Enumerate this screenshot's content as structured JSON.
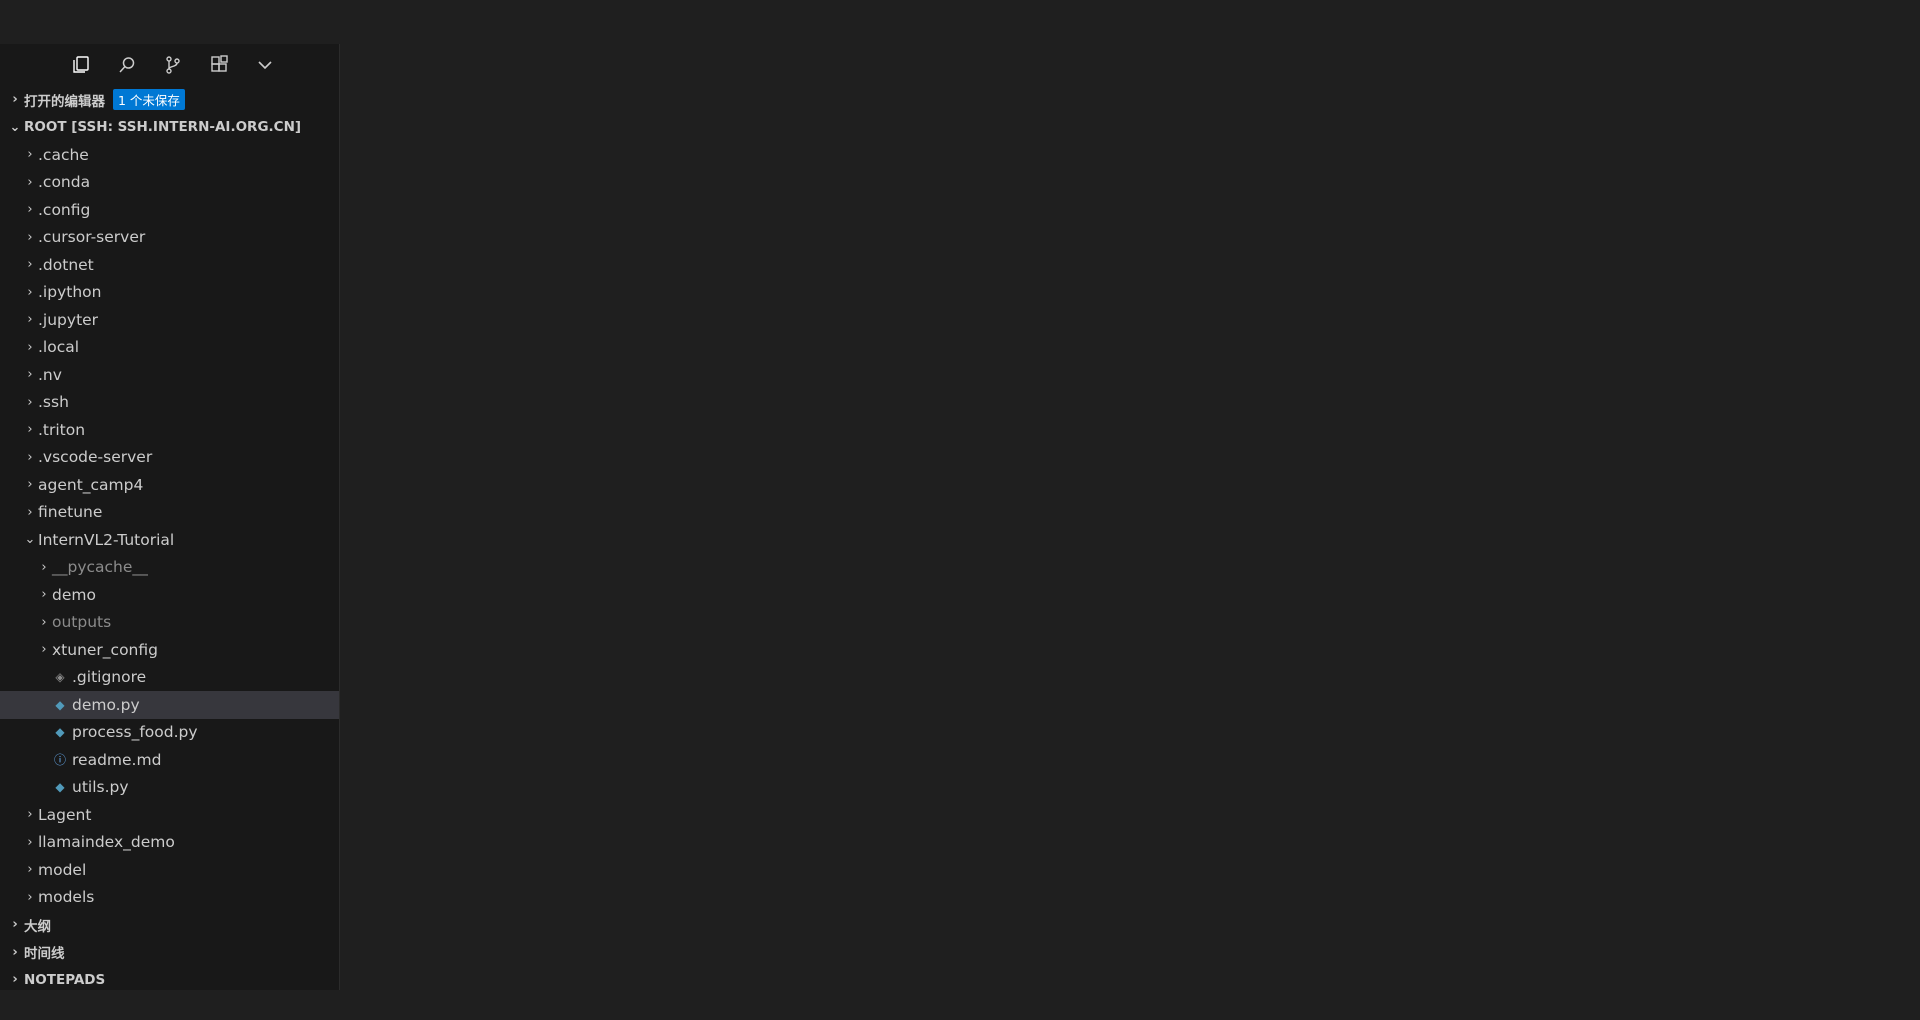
{
  "sections": {
    "open_editors": {
      "label": "打开的编辑器",
      "badge": "1 个未保存"
    },
    "root": {
      "label": "ROOT [SSH: SSH.INTERN-AI.ORG.CN]"
    },
    "outline": {
      "label": "大纲"
    },
    "timeline": {
      "label": "时间线"
    },
    "notepads": {
      "label": "NOTEPADS"
    }
  },
  "tree": [
    {
      "label": ".cache",
      "kind": "folder",
      "depth": 1,
      "expanded": false
    },
    {
      "label": ".conda",
      "kind": "folder",
      "depth": 1,
      "expanded": false
    },
    {
      "label": ".config",
      "kind": "folder",
      "depth": 1,
      "expanded": false
    },
    {
      "label": ".cursor-server",
      "kind": "folder",
      "depth": 1,
      "expanded": false
    },
    {
      "label": ".dotnet",
      "kind": "folder",
      "depth": 1,
      "expanded": false
    },
    {
      "label": ".ipython",
      "kind": "folder",
      "depth": 1,
      "expanded": false
    },
    {
      "label": ".jupyter",
      "kind": "folder",
      "depth": 1,
      "expanded": false
    },
    {
      "label": ".local",
      "kind": "folder",
      "depth": 1,
      "expanded": false
    },
    {
      "label": ".nv",
      "kind": "folder",
      "depth": 1,
      "expanded": false
    },
    {
      "label": ".ssh",
      "kind": "folder",
      "depth": 1,
      "expanded": false
    },
    {
      "label": ".triton",
      "kind": "folder",
      "depth": 1,
      "expanded": false
    },
    {
      "label": ".vscode-server",
      "kind": "folder",
      "depth": 1,
      "expanded": false
    },
    {
      "label": "agent_camp4",
      "kind": "folder",
      "depth": 1,
      "expanded": false
    },
    {
      "label": "finetune",
      "kind": "folder",
      "depth": 1,
      "expanded": false
    },
    {
      "label": "InternVL2-Tutorial",
      "kind": "folder",
      "depth": 1,
      "expanded": true
    },
    {
      "label": "__pycache__",
      "kind": "folder",
      "depth": 2,
      "expanded": false,
      "dim": true
    },
    {
      "label": "demo",
      "kind": "folder",
      "depth": 2,
      "expanded": false
    },
    {
      "label": "outputs",
      "kind": "folder",
      "depth": 2,
      "expanded": false,
      "dim": true
    },
    {
      "label": "xtuner_config",
      "kind": "folder",
      "depth": 2,
      "expanded": false
    },
    {
      "label": ".gitignore",
      "kind": "file",
      "icon": "git-icon",
      "depth": 2
    },
    {
      "label": "demo.py",
      "kind": "file",
      "icon": "python-file-icon",
      "depth": 2,
      "selected": true
    },
    {
      "label": "process_food.py",
      "kind": "file",
      "icon": "python-file-icon",
      "depth": 2
    },
    {
      "label": "readme.md",
      "kind": "file",
      "icon": "info-icon",
      "depth": 2
    },
    {
      "label": "utils.py",
      "kind": "file",
      "icon": "python-file-icon",
      "depth": 2
    },
    {
      "label": "Lagent",
      "kind": "folder",
      "depth": 1,
      "expanded": false
    },
    {
      "label": "llamaindex_demo",
      "kind": "folder",
      "depth": 1,
      "expanded": false
    },
    {
      "label": "model",
      "kind": "folder",
      "depth": 1,
      "expanded": false
    },
    {
      "label": "models",
      "kind": "folder",
      "depth": 1,
      "expanded": false
    }
  ],
  "colors": {
    "python_icon": "#519aba",
    "git_icon": "#8b8b8b",
    "info_icon": "#6cb6ff",
    "badge": "#0078d4",
    "selected_row": "#37373d"
  }
}
